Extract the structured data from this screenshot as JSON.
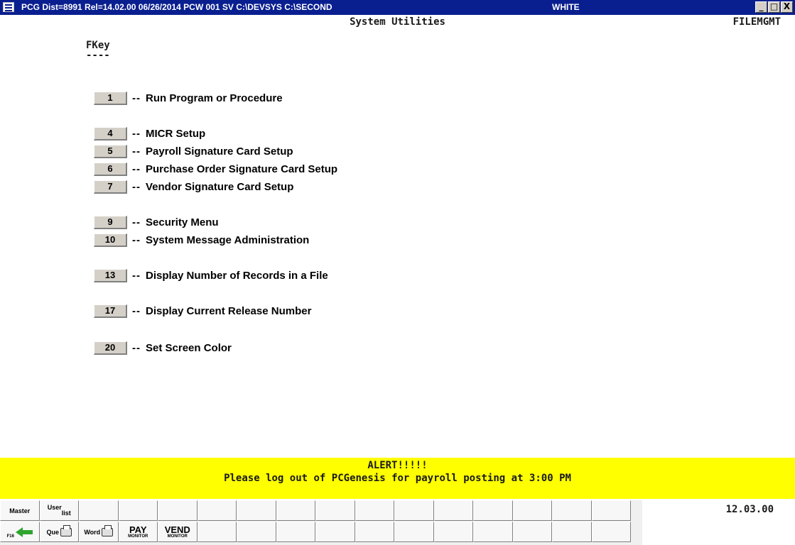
{
  "window": {
    "title": "PCG Dist=8991  Rel=14.02.00  06/26/2014  PCW 001  SV  C:\\DEVSYS  C:\\SECOND",
    "color_scheme": "WHITE",
    "minimize": "_",
    "maximize": "□",
    "close": "X"
  },
  "header": {
    "title": "System Utilities",
    "screen_id": "FILEMGMT"
  },
  "fkey_heading": "FKey",
  "fkey_rule": "----",
  "menu": [
    {
      "key": "1",
      "sep": "--",
      "label": "Run Program or Procedure"
    },
    {
      "key": "4",
      "sep": "--",
      "label": "MICR Setup"
    },
    {
      "key": "5",
      "sep": "--",
      "label": "Payroll Signature Card Setup"
    },
    {
      "key": "6",
      "sep": "--",
      "label": "Purchase Order Signature Card Setup"
    },
    {
      "key": "7",
      "sep": "--",
      "label": "Vendor Signature Card Setup"
    },
    {
      "key": "9",
      "sep": "--",
      "label": "Security Menu"
    },
    {
      "key": "10",
      "sep": "--",
      "label": "System Message Administration"
    },
    {
      "key": "13",
      "sep": "--",
      "label": "Display Number of Records in a File"
    },
    {
      "key": "17",
      "sep": "--",
      "label": "Display Current Release Number"
    },
    {
      "key": "20",
      "sep": "--",
      "label": "Set Screen Color"
    }
  ],
  "alert": {
    "title": "ALERT!!!!!",
    "message": "Please log out of PCGenesis for payroll posting at 3:00 PM",
    "color": "#ffff00"
  },
  "toolbar": {
    "master": "Master",
    "user_list_a": "User",
    "user_list_b": "list",
    "f16": "F16",
    "que": "Que",
    "word": "Word",
    "pay": "PAY",
    "pay_sub": "MONITOR",
    "vend": "VEND",
    "vend_sub": "MONITOR"
  },
  "time": "12.03.00"
}
